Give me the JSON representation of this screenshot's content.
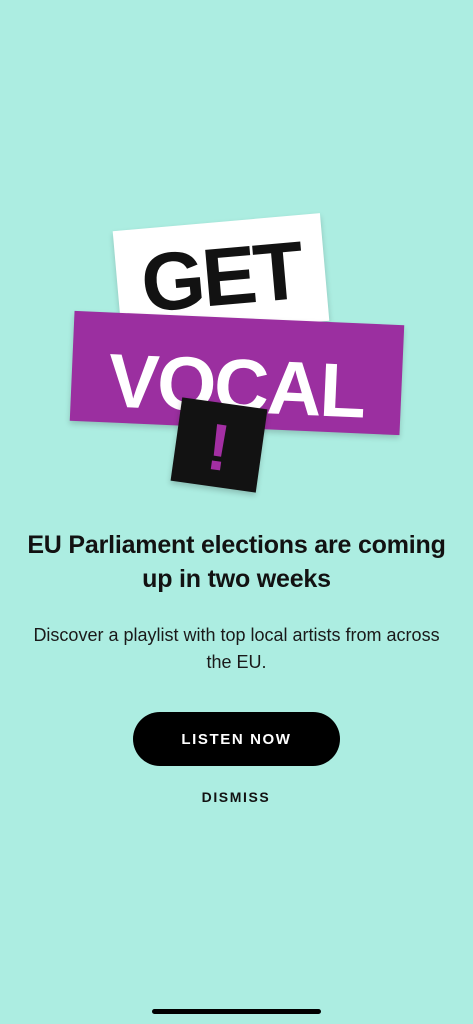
{
  "hero": {
    "line1": "GET",
    "line2": "VOCAL",
    "line3": "!"
  },
  "headline": "EU Parliament elections are coming up in two weeks",
  "body": "Discover a playlist with top local artists from across the EU.",
  "actions": {
    "primary_label": "LISTEN NOW",
    "secondary_label": "DISMISS"
  },
  "colors": {
    "background": "#acede1",
    "sticker_purple": "#9b2fa0",
    "sticker_white": "#ffffff",
    "sticker_black": "#121212",
    "button": "#000000"
  }
}
